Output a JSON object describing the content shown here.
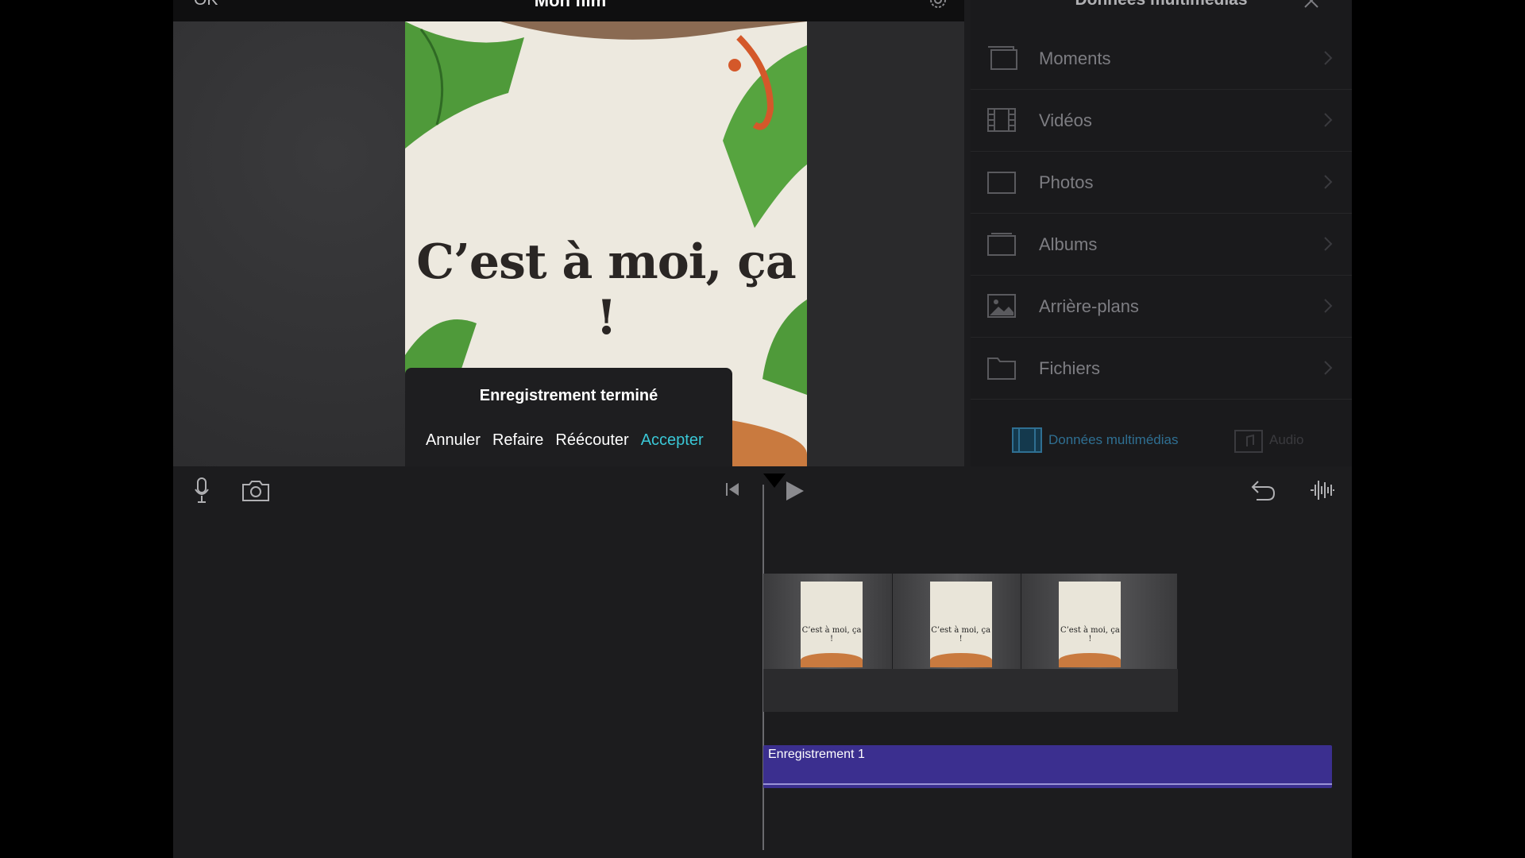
{
  "topbar": {
    "ok_label": "OK",
    "project_title": "Mon film"
  },
  "viewer": {
    "book_title": "C’est à moi, ça !",
    "recording_popup": {
      "title": "Enregistrement terminé",
      "actions": [
        "Annuler",
        "Refaire",
        "Réécouter",
        "Accepter"
      ]
    }
  },
  "media_panel": {
    "title": "Données multimédias",
    "items": [
      {
        "label": "Moments",
        "icon": "moments-icon"
      },
      {
        "label": "Vidéos",
        "icon": "film-icon"
      },
      {
        "label": "Photos",
        "icon": "photo-frame-icon"
      },
      {
        "label": "Albums",
        "icon": "albums-icon"
      },
      {
        "label": "Arrière-plans",
        "icon": "image-icon"
      },
      {
        "label": "Fichiers",
        "icon": "folder-icon"
      }
    ],
    "tabs": {
      "media": "Données multimédias",
      "audio": "Audio"
    }
  },
  "timeline": {
    "thumb_title": "C’est à moi, ça !",
    "audio_clip_label": "Enregistrement 1"
  },
  "colors": {
    "accent": "#3ac7d6",
    "audio_clip": "#3b2f8f",
    "background": "#1c1c1e"
  }
}
